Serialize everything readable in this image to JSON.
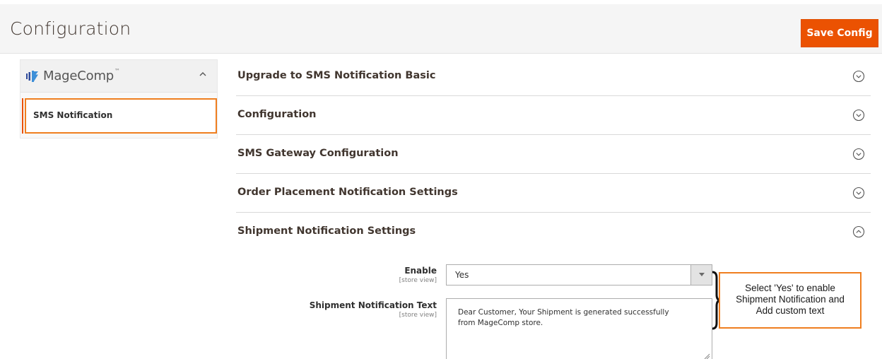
{
  "header": {
    "title": "Configuration",
    "save_label": "Save Config"
  },
  "sidebar": {
    "brand": "MageComp",
    "brand_tm": "™",
    "collapse_icon": "chevron-up-icon",
    "items": [
      {
        "label": "SMS Notification",
        "active": true
      }
    ]
  },
  "sections": [
    {
      "label": "Upgrade to SMS Notification Basic",
      "expanded": false
    },
    {
      "label": "Configuration",
      "expanded": false
    },
    {
      "label": "SMS Gateway Configuration",
      "expanded": false
    },
    {
      "label": "Order Placement Notification Settings",
      "expanded": false
    },
    {
      "label": "Shipment Notification Settings",
      "expanded": true
    }
  ],
  "form": {
    "enable": {
      "label": "Enable",
      "scope": "[store view]",
      "value": "Yes"
    },
    "shipment_text": {
      "label": "Shipment Notification Text",
      "scope": "[store view]",
      "value": "Dear Customer, Your Shipment is generated successfully\nfrom MageComp store."
    }
  },
  "callout": {
    "text": "Select 'Yes' to enable\nShipment Notification and\nAdd custom text"
  },
  "colors": {
    "accent": "#eb5202",
    "highlight": "#ef7e1f"
  }
}
